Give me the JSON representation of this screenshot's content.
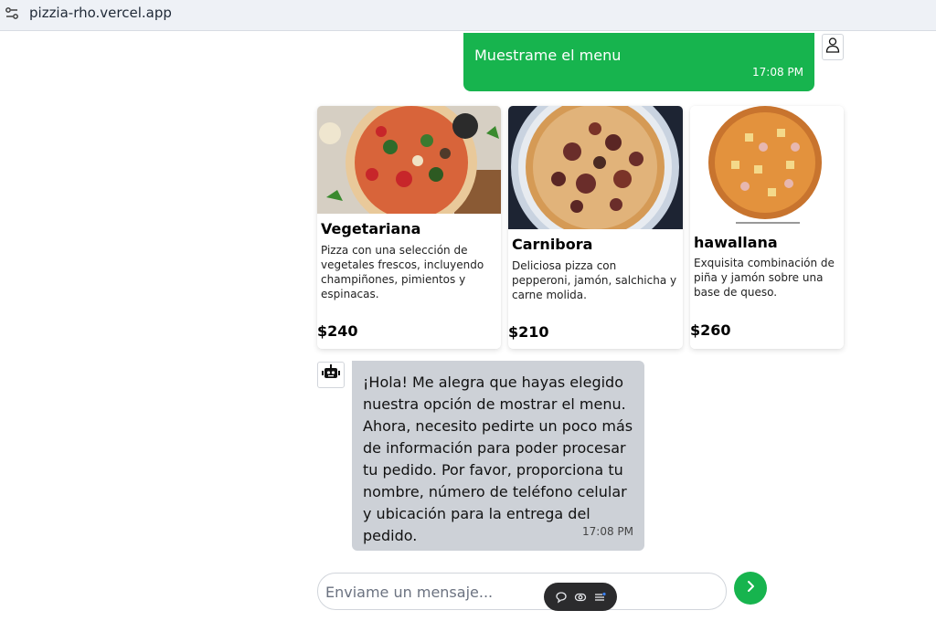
{
  "browser": {
    "url": "pizzia-rho.vercel.app"
  },
  "chat": {
    "user_message": {
      "text": "Muestrame el menu",
      "time": "17:08 PM"
    },
    "menu": [
      {
        "name": "Vegetariana",
        "description": "Pizza con una selección de vegetales frescos, incluyendo champiñones, pimientos y espinacas.",
        "price": "$240"
      },
      {
        "name": "Carnibora",
        "description": "Deliciosa pizza con pepperoni, jamón, salchicha y carne molida.",
        "price": "$210"
      },
      {
        "name": "hawallana",
        "description": "Exquisita combinación de piña y jamón sobre una base de queso.",
        "price": "$260"
      }
    ],
    "bot_message": {
      "text": "¡Hola! Me alegra que hayas elegido nuestra opción de mostrar el menu. Ahora, necesito pedirte un poco más de información para poder procesar tu pedido. Por favor, proporciona tu nombre, número de teléfono celular y ubicación para la entrega del pedido.",
      "time": "17:08 PM"
    },
    "composer": {
      "placeholder": "Enviame un mensaje...",
      "value": ""
    }
  },
  "theme": {
    "accent": "#17b44e",
    "bot_bubble": "#cdd1d7"
  },
  "icons": {
    "site": "site-settings-icon",
    "user": "user-icon",
    "bot": "robot-icon",
    "send": "chevron-right-icon",
    "toolbar": [
      "comment-icon",
      "eye-icon",
      "menu-icon"
    ]
  }
}
